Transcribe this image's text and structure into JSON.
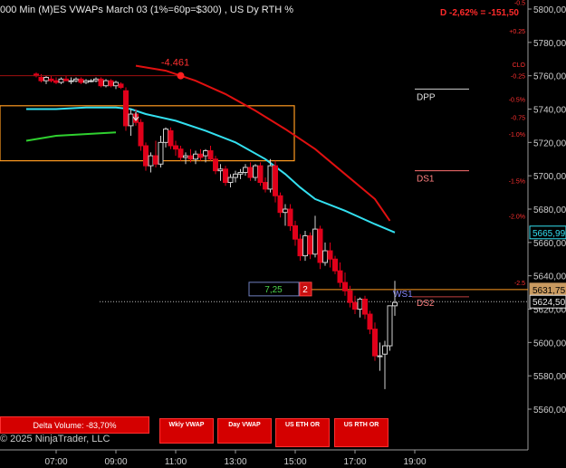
{
  "header": {
    "title": "000 Min (M)ES VWAPs March 03 (1%=60p=$300) , US Dy RTH %",
    "drawdown": "D -2,62% = -151,50"
  },
  "footer": {
    "copyright": "© 2025 NinjaTrader, LLC"
  },
  "buttons": {
    "delta_volume": "Delta Volume: -83,70%",
    "wkly_vwap": "Wkly VWAP",
    "day_vwap": "Day VWAP",
    "us_eth_or": "US ETH OR",
    "us_rth_or": "US RTH OR"
  },
  "annotations": {
    "marker_value": "-4.461",
    "dpp": "DPP",
    "ds1": "DS1",
    "ws1": "WS1",
    "ds2": "DS2",
    "order_qty_green": "7,25",
    "order_qty_red": "2"
  },
  "axis": {
    "price_ticks": [
      "5800,00",
      "5780,00",
      "5760,00",
      "5740,00",
      "5720,00",
      "5700,00",
      "5680,00",
      "5660,00",
      "5640,00",
      "5620,00",
      "5600,00",
      "5580,00",
      "5560,00"
    ],
    "pct_ticks": [
      "-0.5",
      "+0.25",
      "CLO",
      "-0.25",
      "-0.5%",
      "-0.75",
      "-1.0%",
      "-1.5%",
      "-2.0%",
      "-2.5"
    ],
    "time_ticks": [
      "07:00",
      "09:00",
      "11:00",
      "13:00",
      "15:00",
      "17:00",
      "19:00"
    ],
    "price_labels": {
      "cyan_vwap": "5665,99",
      "order_line": "5631,75",
      "last_price": "5624,50"
    }
  },
  "colors": {
    "up_candle": "#000000",
    "down_candle": "#e0001a",
    "vwap_cyan": "#33e0f0",
    "vwap_red": "#e01010",
    "vwap_green": "#2fd02f",
    "box_orange": "#ff9a20",
    "background": "#000000"
  },
  "chart_data": {
    "type": "candlestick",
    "title": "000 Min (M)ES VWAPs March 03 (1%=60p=$300) , US Dy RTH %",
    "xlabel": "",
    "ylabel": "",
    "ylim": [
      5552,
      5804
    ],
    "x_ticks": [
      "07:00",
      "09:00",
      "11:00",
      "13:00",
      "15:00",
      "17:00",
      "19:00"
    ],
    "candles": [
      {
        "t": "06:20",
        "o": 5761,
        "h": 5762,
        "l": 5759,
        "c": 5760
      },
      {
        "t": "06:30",
        "o": 5759,
        "h": 5761,
        "l": 5756,
        "c": 5757
      },
      {
        "t": "06:40",
        "o": 5757,
        "h": 5760,
        "l": 5755,
        "c": 5759
      },
      {
        "t": "06:50",
        "o": 5758,
        "h": 5760,
        "l": 5756,
        "c": 5757
      },
      {
        "t": "07:00",
        "o": 5757,
        "h": 5759,
        "l": 5755,
        "c": 5756
      },
      {
        "t": "07:10",
        "o": 5756,
        "h": 5759,
        "l": 5755,
        "c": 5758
      },
      {
        "t": "07:20",
        "o": 5758,
        "h": 5760,
        "l": 5757,
        "c": 5757
      },
      {
        "t": "07:30",
        "o": 5757,
        "h": 5759,
        "l": 5755,
        "c": 5757
      },
      {
        "t": "07:40",
        "o": 5757,
        "h": 5759,
        "l": 5756,
        "c": 5758
      },
      {
        "t": "07:50",
        "o": 5758,
        "h": 5759,
        "l": 5755,
        "c": 5756
      },
      {
        "t": "08:00",
        "o": 5756,
        "h": 5758,
        "l": 5755,
        "c": 5757
      },
      {
        "t": "08:10",
        "o": 5757,
        "h": 5758,
        "l": 5756,
        "c": 5757
      },
      {
        "t": "08:20",
        "o": 5757,
        "h": 5759,
        "l": 5756,
        "c": 5758
      },
      {
        "t": "08:30",
        "o": 5758,
        "h": 5759,
        "l": 5753,
        "c": 5754
      },
      {
        "t": "08:40",
        "o": 5754,
        "h": 5758,
        "l": 5753,
        "c": 5757
      },
      {
        "t": "08:50",
        "o": 5757,
        "h": 5758,
        "l": 5753,
        "c": 5754
      },
      {
        "t": "09:00",
        "o": 5754,
        "h": 5757,
        "l": 5752,
        "c": 5756
      },
      {
        "t": "09:10",
        "o": 5755,
        "h": 5756,
        "l": 5752,
        "c": 5753
      },
      {
        "t": "09:20",
        "o": 5751,
        "h": 5753,
        "l": 5727,
        "c": 5730
      },
      {
        "t": "09:30",
        "o": 5730,
        "h": 5740,
        "l": 5724,
        "c": 5737
      },
      {
        "t": "09:40",
        "o": 5737,
        "h": 5740,
        "l": 5730,
        "c": 5732
      },
      {
        "t": "09:50",
        "o": 5732,
        "h": 5734,
        "l": 5715,
        "c": 5718
      },
      {
        "t": "10:00",
        "o": 5718,
        "h": 5720,
        "l": 5703,
        "c": 5706
      },
      {
        "t": "10:10",
        "o": 5706,
        "h": 5714,
        "l": 5702,
        "c": 5712
      },
      {
        "t": "10:20",
        "o": 5712,
        "h": 5721,
        "l": 5705,
        "c": 5707
      },
      {
        "t": "10:30",
        "o": 5707,
        "h": 5724,
        "l": 5705,
        "c": 5720
      },
      {
        "t": "10:40",
        "o": 5720,
        "h": 5729,
        "l": 5717,
        "c": 5728
      },
      {
        "t": "10:50",
        "o": 5727,
        "h": 5729,
        "l": 5716,
        "c": 5718
      },
      {
        "t": "11:00",
        "o": 5718,
        "h": 5721,
        "l": 5712,
        "c": 5716
      },
      {
        "t": "11:10",
        "o": 5716,
        "h": 5718,
        "l": 5709,
        "c": 5711
      },
      {
        "t": "11:20",
        "o": 5711,
        "h": 5714,
        "l": 5707,
        "c": 5712
      },
      {
        "t": "11:30",
        "o": 5712,
        "h": 5716,
        "l": 5708,
        "c": 5710
      },
      {
        "t": "11:40",
        "o": 5710,
        "h": 5715,
        "l": 5707,
        "c": 5713
      },
      {
        "t": "11:50",
        "o": 5713,
        "h": 5716,
        "l": 5709,
        "c": 5711
      },
      {
        "t": "12:00",
        "o": 5712,
        "h": 5716,
        "l": 5708,
        "c": 5715
      },
      {
        "t": "12:10",
        "o": 5715,
        "h": 5718,
        "l": 5709,
        "c": 5710
      },
      {
        "t": "12:20",
        "o": 5710,
        "h": 5712,
        "l": 5701,
        "c": 5703
      },
      {
        "t": "12:30",
        "o": 5703,
        "h": 5707,
        "l": 5697,
        "c": 5704
      },
      {
        "t": "12:40",
        "o": 5704,
        "h": 5706,
        "l": 5694,
        "c": 5696
      },
      {
        "t": "12:50",
        "o": 5696,
        "h": 5701,
        "l": 5693,
        "c": 5699
      },
      {
        "t": "13:00",
        "o": 5699,
        "h": 5703,
        "l": 5696,
        "c": 5701
      },
      {
        "t": "13:10",
        "o": 5701,
        "h": 5704,
        "l": 5698,
        "c": 5702
      },
      {
        "t": "13:20",
        "o": 5702,
        "h": 5707,
        "l": 5700,
        "c": 5705
      },
      {
        "t": "13:30",
        "o": 5705,
        "h": 5708,
        "l": 5697,
        "c": 5699
      },
      {
        "t": "13:40",
        "o": 5699,
        "h": 5707,
        "l": 5697,
        "c": 5706
      },
      {
        "t": "13:50",
        "o": 5706,
        "h": 5708,
        "l": 5694,
        "c": 5696
      },
      {
        "t": "14:00",
        "o": 5696,
        "h": 5699,
        "l": 5690,
        "c": 5692
      },
      {
        "t": "14:10",
        "o": 5692,
        "h": 5710,
        "l": 5690,
        "c": 5706
      },
      {
        "t": "14:20",
        "o": 5706,
        "h": 5709,
        "l": 5684,
        "c": 5688
      },
      {
        "t": "14:30",
        "o": 5688,
        "h": 5690,
        "l": 5675,
        "c": 5678
      },
      {
        "t": "14:40",
        "o": 5678,
        "h": 5683,
        "l": 5670,
        "c": 5680
      },
      {
        "t": "14:50",
        "o": 5680,
        "h": 5683,
        "l": 5667,
        "c": 5670
      },
      {
        "t": "15:00",
        "o": 5670,
        "h": 5673,
        "l": 5658,
        "c": 5662
      },
      {
        "t": "15:10",
        "o": 5662,
        "h": 5665,
        "l": 5649,
        "c": 5652
      },
      {
        "t": "15:20",
        "o": 5652,
        "h": 5667,
        "l": 5649,
        "c": 5664
      },
      {
        "t": "15:30",
        "o": 5664,
        "h": 5666,
        "l": 5650,
        "c": 5653
      },
      {
        "t": "15:40",
        "o": 5653,
        "h": 5676,
        "l": 5651,
        "c": 5668
      },
      {
        "t": "15:50",
        "o": 5668,
        "h": 5670,
        "l": 5644,
        "c": 5648
      },
      {
        "t": "16:00",
        "o": 5648,
        "h": 5660,
        "l": 5646,
        "c": 5655
      },
      {
        "t": "16:10",
        "o": 5655,
        "h": 5660,
        "l": 5645,
        "c": 5650
      },
      {
        "t": "16:20",
        "o": 5650,
        "h": 5652,
        "l": 5641,
        "c": 5643
      },
      {
        "t": "16:30",
        "o": 5643,
        "h": 5648,
        "l": 5633,
        "c": 5636
      },
      {
        "t": "16:40",
        "o": 5636,
        "h": 5642,
        "l": 5628,
        "c": 5631
      },
      {
        "t": "16:50",
        "o": 5631,
        "h": 5634,
        "l": 5621,
        "c": 5624
      },
      {
        "t": "17:00",
        "o": 5624,
        "h": 5628,
        "l": 5617,
        "c": 5620
      },
      {
        "t": "17:10",
        "o": 5620,
        "h": 5627,
        "l": 5615,
        "c": 5626
      },
      {
        "t": "17:20",
        "o": 5626,
        "h": 5628,
        "l": 5614,
        "c": 5617
      },
      {
        "t": "17:30",
        "o": 5617,
        "h": 5619,
        "l": 5605,
        "c": 5608
      },
      {
        "t": "17:40",
        "o": 5608,
        "h": 5612,
        "l": 5589,
        "c": 5592
      },
      {
        "t": "17:50",
        "o": 5592,
        "h": 5600,
        "l": 5583,
        "c": 5592
      },
      {
        "t": "18:00",
        "o": 5593,
        "h": 5601,
        "l": 5572,
        "c": 5598
      },
      {
        "t": "18:10",
        "o": 5598,
        "h": 5620,
        "l": 5595,
        "c": 5622
      },
      {
        "t": "18:20",
        "o": 5622,
        "h": 5637,
        "l": 5616,
        "c": 5624
      }
    ],
    "lines": [
      {
        "name": "Wkly VWAP",
        "color": "#e01010",
        "points": [
          [
            "09:40",
            5766
          ],
          [
            "10:40",
            5763
          ],
          [
            "11:40",
            5757
          ],
          [
            "12:40",
            5749
          ],
          [
            "13:40",
            5739
          ],
          [
            "14:40",
            5728
          ],
          [
            "15:40",
            5716
          ],
          [
            "16:40",
            5701
          ],
          [
            "17:40",
            5686
          ],
          [
            "18:10",
            5673
          ]
        ]
      },
      {
        "name": "Day VWAP",
        "color": "#33e0f0",
        "points": [
          [
            "06:00",
            5740
          ],
          [
            "07:00",
            5740
          ],
          [
            "08:00",
            5741
          ],
          [
            "09:00",
            5741
          ],
          [
            "09:30",
            5740
          ],
          [
            "10:00",
            5737
          ],
          [
            "11:00",
            5733
          ],
          [
            "12:00",
            5727
          ],
          [
            "13:00",
            5720
          ],
          [
            "14:00",
            5710
          ],
          [
            "14:40",
            5701
          ],
          [
            "15:10",
            5693
          ],
          [
            "15:40",
            5686
          ],
          [
            "16:40",
            5679
          ],
          [
            "17:40",
            5671
          ],
          [
            "18:20",
            5666
          ]
        ]
      },
      {
        "name": "",
        "color": "#2fd02f",
        "points": [
          [
            "06:00",
            5721
          ],
          [
            "07:00",
            5724
          ],
          [
            "08:00",
            5725
          ],
          [
            "09:00",
            5726
          ]
        ]
      }
    ],
    "levels": [
      {
        "label": "DPP",
        "value": 5752,
        "color": "#d0d0d0"
      },
      {
        "label": "DS1",
        "value": 5703,
        "color": "#ff7070"
      },
      {
        "label": "WS1",
        "value": 5631.75,
        "color": "#8080ff"
      },
      {
        "label": "DS2",
        "value": 5624.5,
        "color": "#ff7070"
      }
    ],
    "box": {
      "from": "06:00",
      "to": "15:00",
      "top": 5742,
      "bottom": 5709,
      "color": "#ff9a20"
    },
    "marker": {
      "t": "11:10",
      "value": 5760,
      "label": "-4.461"
    },
    "grid": false,
    "legend": "none"
  }
}
